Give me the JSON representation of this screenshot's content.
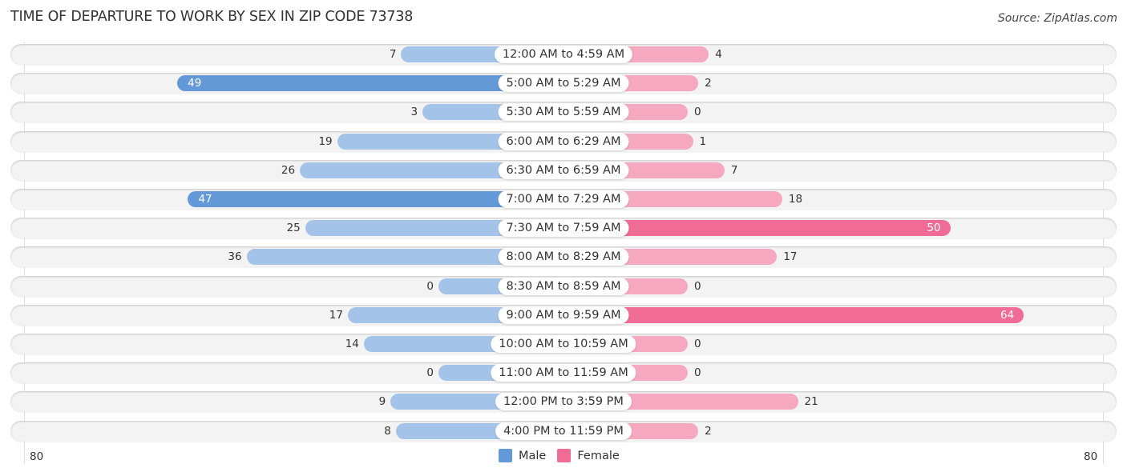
{
  "title": "TIME OF DEPARTURE TO WORK BY SEX IN ZIP CODE 73738",
  "source": "Source: ZipAtlas.com",
  "colors": {
    "male_strong": "#6399d6",
    "male_light": "#a3c3e8",
    "female_strong": "#f06b96",
    "female_light": "#f5a8c0"
  },
  "chart_data": {
    "type": "bar",
    "orientation": "horizontal-diverging",
    "title": "TIME OF DEPARTURE TO WORK BY SEX IN ZIP CODE 73738",
    "categories": [
      "12:00 AM to 4:59 AM",
      "5:00 AM to 5:29 AM",
      "5:30 AM to 5:59 AM",
      "6:00 AM to 6:29 AM",
      "6:30 AM to 6:59 AM",
      "7:00 AM to 7:29 AM",
      "7:30 AM to 7:59 AM",
      "8:00 AM to 8:29 AM",
      "8:30 AM to 8:59 AM",
      "9:00 AM to 9:59 AM",
      "10:00 AM to 10:59 AM",
      "11:00 AM to 11:59 AM",
      "12:00 PM to 3:59 PM",
      "4:00 PM to 11:59 PM"
    ],
    "series": [
      {
        "name": "Male",
        "values": [
          7,
          49,
          3,
          19,
          26,
          47,
          25,
          36,
          0,
          17,
          14,
          0,
          9,
          8
        ]
      },
      {
        "name": "Female",
        "values": [
          4,
          2,
          0,
          1,
          7,
          18,
          50,
          17,
          0,
          64,
          0,
          0,
          21,
          2
        ]
      }
    ],
    "xlim": [
      -80,
      80
    ],
    "axis_labels": {
      "left": "80",
      "right": "80"
    },
    "legend": {
      "position": "bottom-center",
      "entries": [
        "Male",
        "Female"
      ]
    },
    "grid": false
  }
}
